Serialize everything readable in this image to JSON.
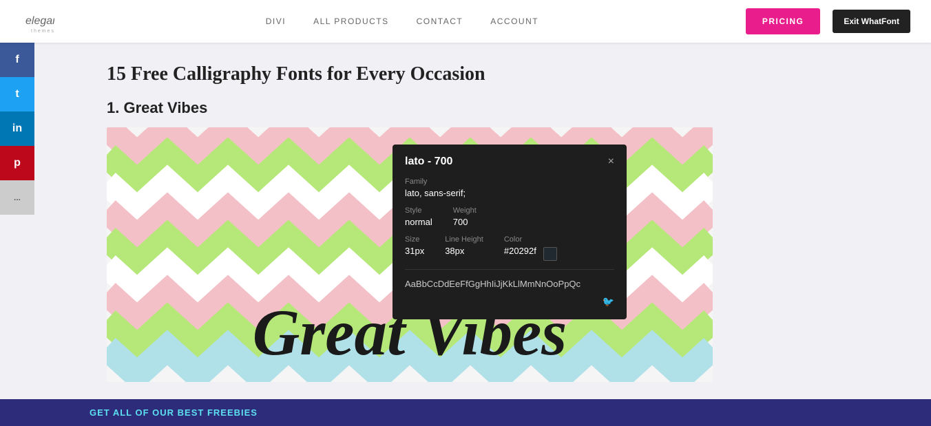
{
  "header": {
    "logo": {
      "elegant": "elegant",
      "star": "✦",
      "themes": "themes"
    },
    "nav": {
      "divi": "DIVI",
      "all_products": "ALL PRODUCTS",
      "contact": "CONTACT",
      "account": "ACCOUNT"
    },
    "pricing_label": "PRICING",
    "exit_whatfont_label": "Exit WhatFont"
  },
  "social": {
    "facebook": "f",
    "twitter": "t",
    "linkedin": "in",
    "pinterest": "p",
    "more": "..."
  },
  "article": {
    "title": "15 Free Calligraphy Fonts for Every Occasion",
    "section_heading": "1. Great Vibes"
  },
  "popup": {
    "title": "lato - 700",
    "close": "×",
    "family_label": "Family",
    "family_value": "lato, sans-serif;",
    "style_label": "Style",
    "style_value": "normal",
    "weight_label": "Weight",
    "weight_value": "700",
    "size_label": "Size",
    "size_value": "31px",
    "line_height_label": "Line Height",
    "line_height_value": "38px",
    "color_label": "Color",
    "color_value": "#20292f",
    "color_hex": "#20292f",
    "alphabet": "AaBbCcDdEeFfGgHhIiJjKkLlMmNnOoPpQc"
  },
  "bottom_bar": {
    "text": "GET ALL OF OUR BEST FREEBIES"
  },
  "colors": {
    "pricing_bg": "#e91e8c",
    "exit_bg": "#333",
    "popup_bg": "#1e1e1e",
    "sidebar_bg": "#2c2c7a",
    "sidebar_text": "#5ce0f0"
  }
}
